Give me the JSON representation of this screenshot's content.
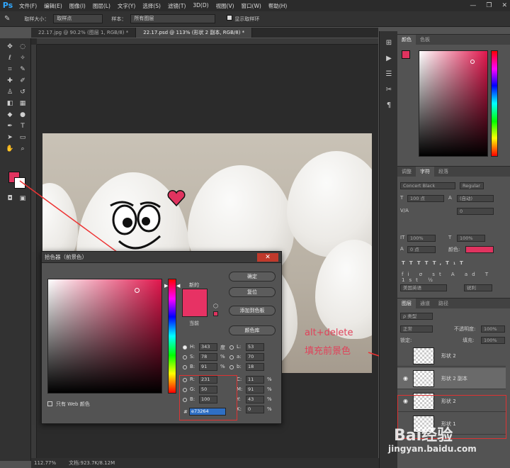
{
  "app": {
    "logo": "Ps"
  },
  "menu": [
    "文件(F)",
    "编辑(E)",
    "图像(I)",
    "图层(L)",
    "文字(Y)",
    "选择(S)",
    "滤镜(T)",
    "3D(D)",
    "视图(V)",
    "窗口(W)",
    "帮助(H)"
  ],
  "window_controls": [
    "—",
    "❐",
    "✕"
  ],
  "options": {
    "sample_size_label": "取样大小：",
    "sample_size_value": "取样点",
    "sample_label": "样本：",
    "sample_value": "所有图层",
    "show_ring_label": "显示取样环"
  },
  "tabs": [
    {
      "label": "22.17.jpg @ 90.2% (图层 1, RGB/8) *"
    },
    {
      "label": "22.17.psd @ 113% (形状 2 副本, RGB/8) *"
    }
  ],
  "status": {
    "zoom": "112.77%",
    "doc": "文档:923.7K/8.12M"
  },
  "color_panel": {
    "tabs": [
      "颜色",
      "色板"
    ],
    "fg_color": "#e0335f"
  },
  "char_panel": {
    "tabs": [
      "调整",
      "字符",
      "段落"
    ],
    "font": "Concert Black",
    "style": "Regular",
    "size": "100 点",
    "leading": "(自动)",
    "tracking": "0",
    "scale_v": "100%",
    "scale_h": "100%",
    "baseline": "0 点",
    "color_label": "颜色:",
    "color": "#e0335f",
    "lang": "美国英语",
    "aa": "锐利"
  },
  "layers_panel": {
    "tabs": [
      "图层",
      "通道",
      "路径"
    ],
    "kind": "ρ 类型",
    "blend": "正常",
    "opacity_label": "不透明度:",
    "opacity": "100%",
    "lock_label": "锁定:",
    "fill_label": "填充:",
    "fill": "100%",
    "layers": [
      {
        "name": "形状 2",
        "visible": false,
        "selected": false
      },
      {
        "name": "形状 2 副本",
        "visible": true,
        "selected": true
      },
      {
        "name": "形状 2",
        "visible": true,
        "selected": false
      },
      {
        "name": "形状 1",
        "visible": false,
        "selected": false
      }
    ]
  },
  "picker": {
    "title": "拾色器（前景色）",
    "new_label": "新的",
    "current_label": "当前",
    "ok": "确定",
    "reset": "复位",
    "add_swatch": "添加到色板",
    "libraries": "颜色库",
    "web_only": "只有 Web 颜色",
    "new_color": "#e73264",
    "hsb": {
      "H": "343",
      "S": "78",
      "B": "91"
    },
    "rgb": {
      "R": "231",
      "G": "50",
      "B": "100"
    },
    "lab": {
      "L": "53",
      "a": "70",
      "b": "18"
    },
    "cmyk": {
      "C": "11",
      "M": "91",
      "Y": "43",
      "K": "0"
    },
    "hex": "e73264",
    "units": {
      "deg": "度",
      "pct": "%"
    }
  },
  "annotation": {
    "line1": "alt+delete",
    "line2": "填充前景色"
  },
  "watermark": {
    "brand": "Bai经验",
    "url": "jingyan.baidu.com"
  }
}
